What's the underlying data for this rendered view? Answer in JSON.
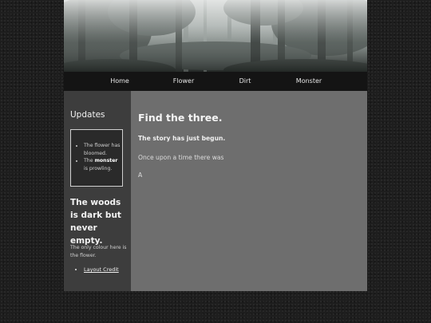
{
  "nav": {
    "items": [
      {
        "label": "Home"
      },
      {
        "label": "Flower"
      },
      {
        "label": "Dirt"
      },
      {
        "label": "Monster"
      }
    ]
  },
  "sidebar": {
    "title": "Updates",
    "updates": [
      {
        "pre": "The flower has bloomed.",
        "bold": "",
        "post": ""
      },
      {
        "pre": "The ",
        "bold": "monster",
        "post": " is prowling."
      }
    ],
    "heading": "The woods is dark but never empty.",
    "note": "The only colour here is the flower.",
    "credit_link": "Layout Credit"
  },
  "main": {
    "title": "Find the three.",
    "subtitle": "The story has just begun.",
    "paragraph1": "Once upon a time there was",
    "paragraph2": "A"
  },
  "colors": {
    "page_background": "#1e1e1e",
    "nav_bar": "#141414",
    "sidebar": "#3d3d3d",
    "main_panel": "#6e6e6e"
  }
}
